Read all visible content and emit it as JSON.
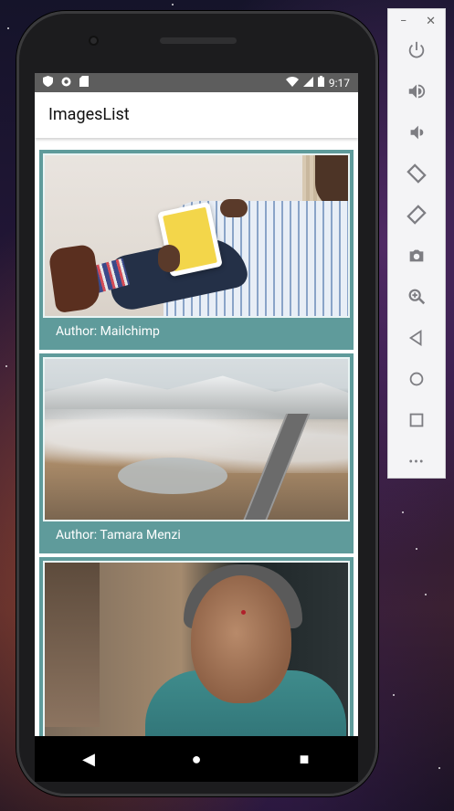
{
  "status_bar": {
    "time": "9:17"
  },
  "app": {
    "title": "ImagesList"
  },
  "cards": [
    {
      "caption": "Author: Mailchimp"
    },
    {
      "caption": "Author: Tamara Menzi"
    },
    {
      "caption": ""
    }
  ],
  "nav": {
    "back": "◀",
    "home": "●",
    "recents": "■"
  },
  "toolbar": {
    "minimize": "−",
    "close": "✕",
    "buttons": [
      "power-icon",
      "volume-up-icon",
      "volume-down-icon",
      "rotate-left-icon",
      "rotate-right-icon",
      "camera-icon",
      "zoom-icon",
      "back-icon",
      "home-icon",
      "overview-icon",
      "more-icon"
    ],
    "more_label": "•••"
  },
  "colors": {
    "card": "#5f9b9b",
    "statusbar": "#5d5d5d"
  }
}
